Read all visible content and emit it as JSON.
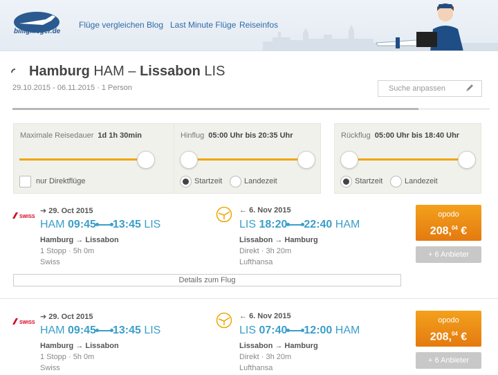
{
  "header": {
    "logo_text": "billigflieger.de",
    "nav": [
      "Flüge vergleichen",
      "Blog",
      "Last Minute Flüge",
      "Reiseinfos"
    ]
  },
  "search": {
    "origin_city": "Hamburg",
    "origin_code": "HAM",
    "separator": "–",
    "dest_city": "Lissabon",
    "dest_code": "LIS",
    "subtitle": "29.10.2015 - 06.11.2015 · 1 Person",
    "adjust_label": "Suche anpassen",
    "progress": 0.85
  },
  "filters": {
    "duration": {
      "label": "Maximale Reisedauer",
      "value": "1d 1h 30min",
      "checkbox_label": "nur Direktflüge"
    },
    "outbound": {
      "label": "Hinflug",
      "value": "05:00 Uhr bis 20:35 Uhr",
      "radio1": "Startzeit",
      "radio2": "Landezeit"
    },
    "inbound": {
      "label": "Rückflug",
      "value": "05:00 Uhr bis 18:40 Uhr",
      "radio1": "Startzeit",
      "radio2": "Landezeit"
    }
  },
  "results": [
    {
      "out": {
        "airline_logo": "SWISS",
        "date": "29. Oct 2015",
        "from": "HAM",
        "dep": "09:45",
        "arr": "13:45",
        "to": "LIS",
        "route": "Hamburg → Lissabon",
        "stops": "1 Stopp · 5h 0m",
        "airline": "Swiss"
      },
      "ret": {
        "date": "6. Nov 2015",
        "from": "LIS",
        "dep": "18:20",
        "arr": "22:40",
        "to": "HAM",
        "route": "Lissabon → Hamburg",
        "stops": "Direkt · 3h 20m",
        "airline": "Lufthansa"
      },
      "provider": "opodo",
      "price_main": "208,",
      "price_cents": "04",
      "currency": "€",
      "more": "+ 6 Anbieter",
      "details": "Details zum Flug"
    },
    {
      "out": {
        "airline_logo": "SWISS",
        "date": "29. Oct 2015",
        "from": "HAM",
        "dep": "09:45",
        "arr": "13:45",
        "to": "LIS",
        "route": "Hamburg → Lissabon",
        "stops": "1 Stopp · 5h 0m",
        "airline": "Swiss"
      },
      "ret": {
        "date": "6. Nov 2015",
        "from": "LIS",
        "dep": "07:40",
        "arr": "12:00",
        "to": "HAM",
        "route": "Lissabon → Hamburg",
        "stops": "Direkt · 3h 20m",
        "airline": "Lufthansa"
      },
      "provider": "opodo",
      "price_main": "208,",
      "price_cents": "04",
      "currency": "€",
      "more": "+ 6 Anbieter"
    }
  ],
  "colors": {
    "accent": "#f0a500",
    "link": "#3a9ec9",
    "nav": "#2f6aa8"
  }
}
